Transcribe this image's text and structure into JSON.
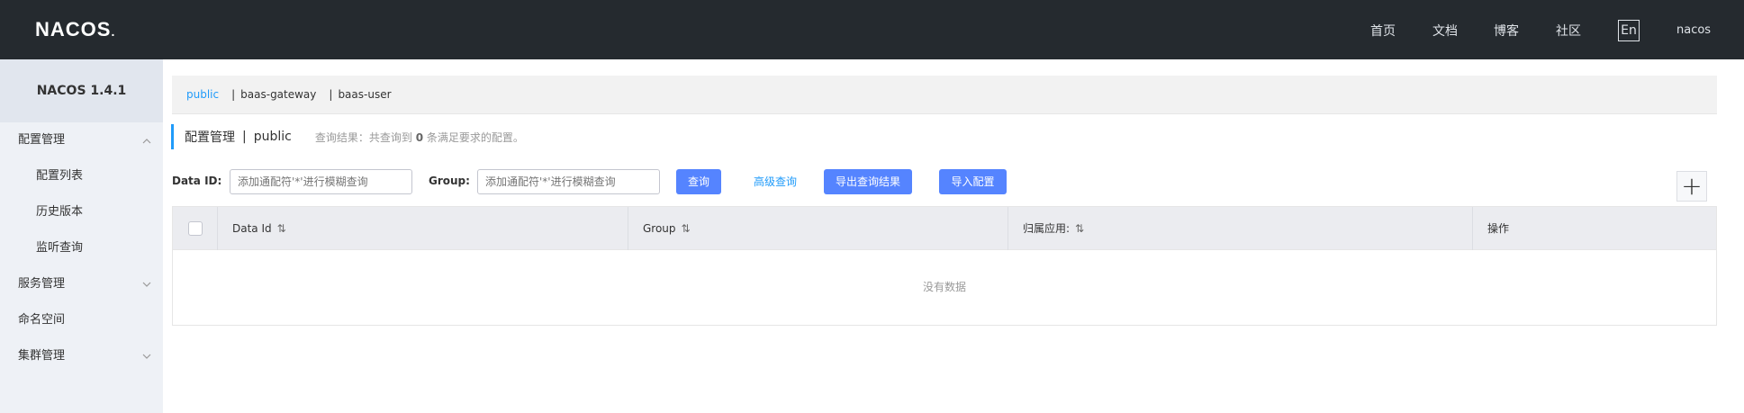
{
  "header": {
    "logo": "NACOS",
    "logo_dot": ".",
    "nav": [
      "首页",
      "文档",
      "博客",
      "社区"
    ],
    "lang": "En",
    "user": "nacos"
  },
  "sidebar": {
    "version": "NACOS 1.4.1",
    "groups": [
      {
        "label": "配置管理",
        "expanded": true,
        "items": [
          "配置列表",
          "历史版本",
          "监听查询"
        ]
      },
      {
        "label": "服务管理",
        "expanded": false
      },
      {
        "label": "命名空间"
      },
      {
        "label": "集群管理",
        "expanded": false
      }
    ]
  },
  "namespaces": [
    "public",
    "baas-gateway",
    "baas-user"
  ],
  "page": {
    "title": "配置管理",
    "namespace": "public",
    "summary_prefix": "查询结果：共查询到",
    "summary_count": "0",
    "summary_suffix": "条满足要求的配置。"
  },
  "search": {
    "dataid_label": "Data ID:",
    "dataid_placeholder": "添加通配符'*'进行模糊查询",
    "group_label": "Group:",
    "group_placeholder": "添加通配符'*'进行模糊查询",
    "query_btn": "查询",
    "advanced_btn": "高级查询",
    "export_btn": "导出查询结果",
    "import_btn": "导入配置"
  },
  "add_button": "+",
  "table": {
    "columns": [
      "Data Id",
      "Group",
      "归属应用:",
      "操作"
    ],
    "sort_icon": "⇅",
    "empty": "没有数据"
  },
  "colors": {
    "header_bg": "#252a2f",
    "sidebar_bg": "#eef1f6",
    "primary": "#5584ff",
    "link": "#209bfa"
  }
}
